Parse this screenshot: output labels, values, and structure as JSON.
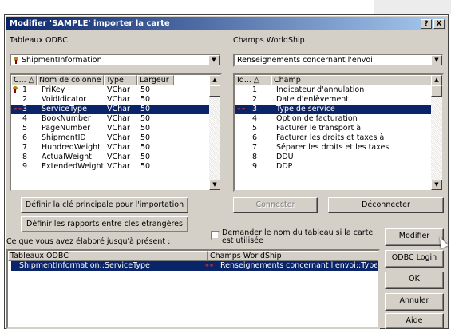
{
  "window": {
    "title": "Modifier 'SAMPLE' importer la carte",
    "help_label": "?",
    "close_label": "X"
  },
  "left": {
    "label": "Tableaux ODBC",
    "combo_value": "ShipmentInformation",
    "columns": [
      "C... △",
      "Nom de colonne",
      "Type",
      "Largeur"
    ],
    "rows": [
      {
        "c": "1",
        "name": "PriKey",
        "type": "VChar",
        "width": "50",
        "icon": "key-icon"
      },
      {
        "c": "2",
        "name": "VoidIdicator",
        "type": "VChar",
        "width": "50",
        "icon": ""
      },
      {
        "c": "3",
        "name": "ServiceType",
        "type": "VChar",
        "width": "50",
        "icon": "link-icon"
      },
      {
        "c": "4",
        "name": "BookNumber",
        "type": "VChar",
        "width": "50",
        "icon": ""
      },
      {
        "c": "5",
        "name": "PageNumber",
        "type": "VChar",
        "width": "50",
        "icon": ""
      },
      {
        "c": "6",
        "name": "ShipmentID",
        "type": "VChar",
        "width": "50",
        "icon": ""
      },
      {
        "c": "7",
        "name": "HundredWeight",
        "type": "VChar",
        "width": "50",
        "icon": ""
      },
      {
        "c": "8",
        "name": "ActualWeight",
        "type": "VChar",
        "width": "50",
        "icon": ""
      },
      {
        "c": "9",
        "name": "ExtendedWeight",
        "type": "VChar",
        "width": "50",
        "icon": ""
      }
    ],
    "selected_row": 2
  },
  "right": {
    "label": "Champs WorldShip",
    "combo_value": "Renseignements concernant l'envoi",
    "columns": [
      "Id... △",
      "Champ"
    ],
    "rows": [
      {
        "id": "1",
        "champ": "Indicateur d'annulation",
        "icon": ""
      },
      {
        "id": "2",
        "champ": "Date d'enlèvement",
        "icon": ""
      },
      {
        "id": "3",
        "champ": "Type de service",
        "icon": "link-icon"
      },
      {
        "id": "4",
        "champ": "Option de facturation",
        "icon": ""
      },
      {
        "id": "5",
        "champ": "Facturer le transport à",
        "icon": ""
      },
      {
        "id": "6",
        "champ": "Facturer les droits et taxes à",
        "icon": ""
      },
      {
        "id": "7",
        "champ": "Séparer les droits et les taxes",
        "icon": ""
      },
      {
        "id": "8",
        "champ": "DDU",
        "icon": ""
      },
      {
        "id": "9",
        "champ": "DDP",
        "icon": ""
      }
    ],
    "selected_row": 2
  },
  "buttons": {
    "define_key": "Définir la clé principale pour l'importation",
    "define_relations": "Définir les rapports entre clés étrangères",
    "connect": "Connecter",
    "disconnect": "Déconnecter",
    "modify": "Modifier",
    "odbc_login": "ODBC Login",
    "ok": "OK",
    "cancel": "Annuler",
    "help": "Aide"
  },
  "checkbox": {
    "label": "Demander le nom du tableau si la carte est utilisée",
    "checked": false
  },
  "summary": {
    "label": "Ce que vous avez élaboré jusqu'à présent :",
    "columns": [
      "Tableaux ODBC",
      "Champs WorldShip"
    ],
    "rows": [
      {
        "odbc": "ShipmentInformation::ServiceType",
        "ws": "Renseignements concernant l'envoi::Type d..."
      }
    ]
  },
  "colors": {
    "title_bar": "#0a246a",
    "selection": "#0a246a",
    "face": "#d4d0c8"
  }
}
